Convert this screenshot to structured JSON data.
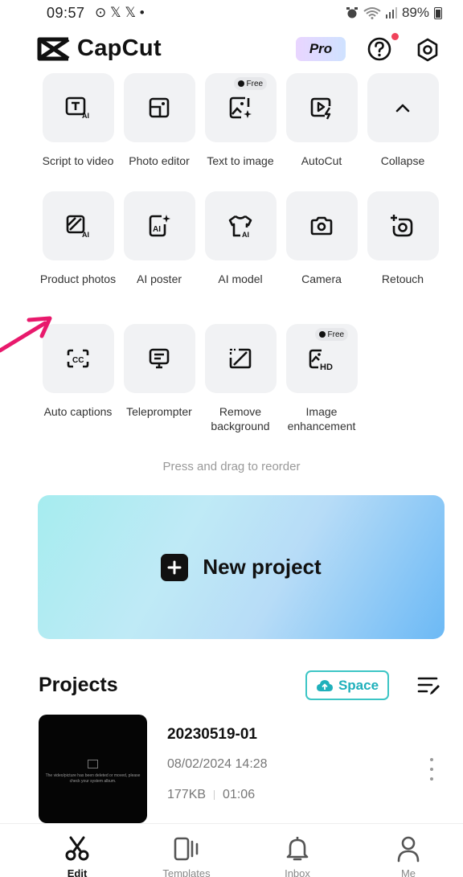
{
  "status_bar": {
    "time": "09:57",
    "left_icons": "⊙ 𝕏 𝕏 •",
    "battery": "89%"
  },
  "header": {
    "app_name": "CapCut",
    "pro_label": "Pro"
  },
  "tools_row1": [
    {
      "label": "Script to video",
      "icon": "script-ai-icon"
    },
    {
      "label": "Photo editor",
      "icon": "photo-editor-icon"
    },
    {
      "label": "Text to image",
      "icon": "text-image-icon",
      "badge": "Free"
    },
    {
      "label": "AutoCut",
      "icon": "autocut-icon"
    },
    {
      "label": "Collapse",
      "icon": "chevron-up-icon"
    }
  ],
  "tools_row2": [
    {
      "label": "Product photos",
      "icon": "product-photo-icon"
    },
    {
      "label": "AI poster",
      "icon": "ai-poster-icon"
    },
    {
      "label": "AI model",
      "icon": "ai-model-icon"
    },
    {
      "label": "Camera",
      "icon": "camera-icon"
    },
    {
      "label": "Retouch",
      "icon": "retouch-icon"
    }
  ],
  "tools_row3": [
    {
      "label": "Auto captions",
      "icon": "captions-icon"
    },
    {
      "label": "Teleprompter",
      "icon": "teleprompter-icon"
    },
    {
      "label": "Remove background",
      "icon": "remove-bg-icon"
    },
    {
      "label": "Image enhancement",
      "icon": "hd-icon",
      "badge": "Free"
    }
  ],
  "reorder_hint": "Press and drag to reorder",
  "new_project": {
    "label": "New project"
  },
  "projects": {
    "title": "Projects",
    "space_label": "Space",
    "items": [
      {
        "name": "20230519-01",
        "date": "08/02/2024 14:28",
        "size": "177KB",
        "duration": "01:06",
        "thumb_text": "The video/picture has been deleted or moved, please check your system album."
      }
    ]
  },
  "bottom_nav": [
    {
      "label": "Edit",
      "icon": "scissors-icon",
      "active": true
    },
    {
      "label": "Templates",
      "icon": "templates-icon",
      "active": false
    },
    {
      "label": "Inbox",
      "icon": "bell-icon",
      "active": false
    },
    {
      "label": "Me",
      "icon": "person-icon",
      "active": false
    }
  ],
  "colors": {
    "accent_teal": "#1fb0bb",
    "annotation_arrow": "#e8196c",
    "notification_dot": "#f0435b"
  }
}
